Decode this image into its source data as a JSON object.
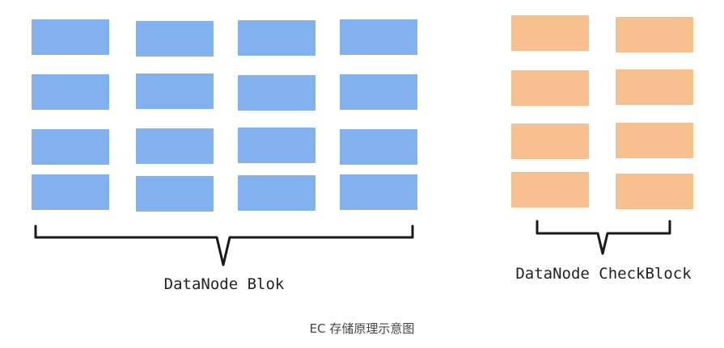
{
  "data_blocks": {
    "label": "DataNode Blok",
    "rows": 4,
    "cols": 4,
    "color": "#82b1ee"
  },
  "check_blocks": {
    "label": "DataNode CheckBlock",
    "rows": 4,
    "cols": 2,
    "color": "#f6c08e"
  },
  "caption": "EC 存储原理示意图"
}
